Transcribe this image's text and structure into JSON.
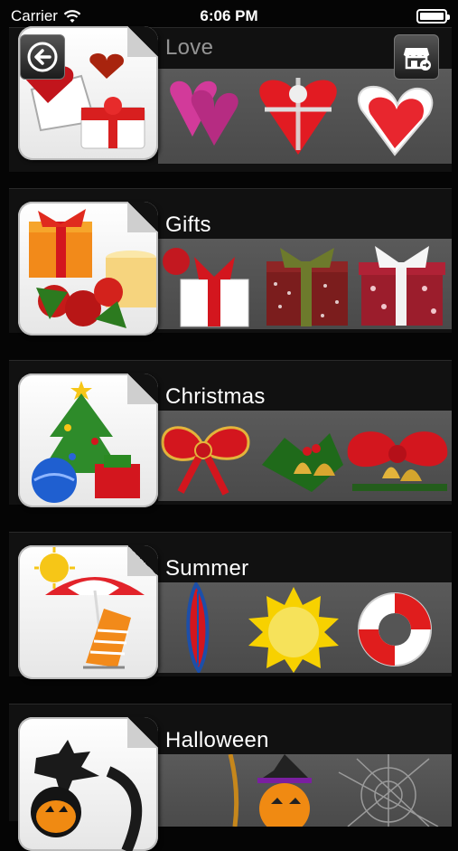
{
  "status_bar": {
    "carrier": "Carrier",
    "time": "6:06 PM"
  },
  "categories": [
    {
      "title": "Love"
    },
    {
      "title": "Gifts"
    },
    {
      "title": "Christmas"
    },
    {
      "title": "Summer"
    },
    {
      "title": "Halloween"
    }
  ],
  "icons": {
    "back": "back-arrow-icon",
    "store": "store-icon",
    "wifi": "wifi-icon",
    "battery": "battery-icon"
  }
}
